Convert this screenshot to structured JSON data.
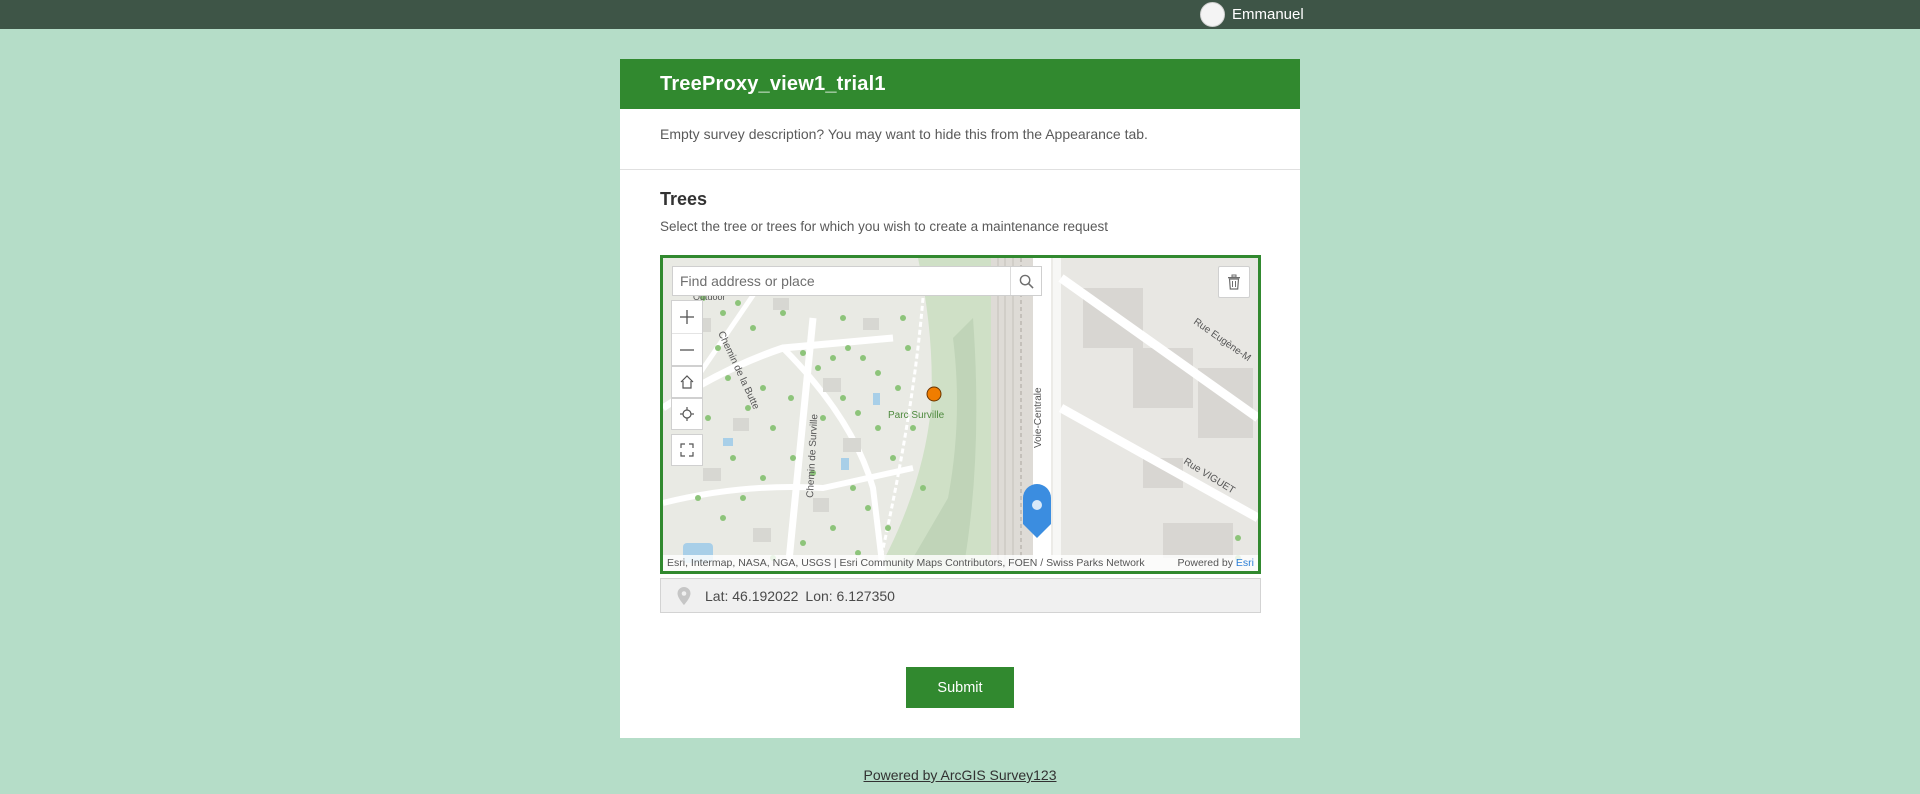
{
  "topbar": {
    "user_name": "Emmanuel"
  },
  "survey": {
    "title": "TreeProxy_view1_trial1",
    "description": "Empty survey description? You may want to hide this from the Appearance tab."
  },
  "question": {
    "title": "Trees",
    "hint": "Select the tree or trees for which you wish to create a maintenance request"
  },
  "map": {
    "search_placeholder": "Find address or place",
    "labels": {
      "park": "Parc Surville",
      "road1": "Voie-Centrale",
      "road2": "Rue Eugène-M",
      "road3": "Rue VIGUET",
      "road4": "Chemin de Surville",
      "road5": "Chemin de la Butte",
      "poi": "Outdoor"
    },
    "attribution": "Esri, Intermap, NASA, NGA, USGS | Esri Community Maps Contributors, FOEN / Swiss Parks Network",
    "powered_by": "Powered by ",
    "powered_by_link": "Esri",
    "colors": {
      "pin": "#3b8de0",
      "marker": "#f07d00",
      "border": "#31892f"
    },
    "icons": [
      "search-icon",
      "trash-icon",
      "zoom-in-icon",
      "zoom-out-icon",
      "home-icon",
      "locate-icon",
      "fullscreen-icon",
      "location-pin-icon"
    ]
  },
  "coords": {
    "lat": "Lat: 46.192022",
    "lon": "Lon: 6.127350"
  },
  "actions": {
    "submit_label": "Submit"
  },
  "footer": {
    "link_text": "Powered by ArcGIS Survey123"
  },
  "theme": {
    "accent": "#31892f",
    "background": "#b5ddc8",
    "topbar": "#3e5547"
  }
}
